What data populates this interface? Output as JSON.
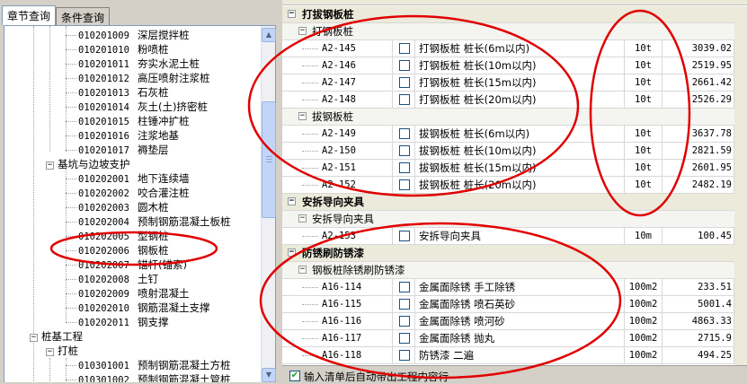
{
  "tabs": [
    {
      "label": "章节查询",
      "active": true
    },
    {
      "label": "条件查询",
      "active": false
    }
  ],
  "tree": {
    "items_a": [
      {
        "code": "010201009",
        "name": "深层搅拌桩"
      },
      {
        "code": "010201010",
        "name": "粉喷桩"
      },
      {
        "code": "010201011",
        "name": "夯实水泥土桩"
      },
      {
        "code": "010201012",
        "name": "高压喷射注浆桩"
      },
      {
        "code": "010201013",
        "name": "石灰桩"
      },
      {
        "code": "010201014",
        "name": "灰土(土)挤密桩"
      },
      {
        "code": "010201015",
        "name": "柱锤冲扩桩"
      },
      {
        "code": "010201016",
        "name": "注浆地基"
      },
      {
        "code": "010201017",
        "name": "褥垫层"
      }
    ],
    "group_pit": "基坑与边坡支护",
    "items_b": [
      {
        "code": "010202001",
        "name": "地下连续墙"
      },
      {
        "code": "010202002",
        "name": "咬合灌注桩"
      },
      {
        "code": "010202003",
        "name": "圆木桩"
      },
      {
        "code": "010202004",
        "name": "预制钢筋混凝土板桩"
      },
      {
        "code": "010202005",
        "name": "型钢桩"
      },
      {
        "code": "010202006",
        "name": "钢板桩"
      },
      {
        "code": "010202007",
        "name": "锚杆(锚索)"
      },
      {
        "code": "010202008",
        "name": "土钉"
      },
      {
        "code": "010202009",
        "name": "喷射混凝土"
      },
      {
        "code": "010202010",
        "name": "钢筋混凝土支撑"
      },
      {
        "code": "010202011",
        "name": "钢支撑"
      }
    ],
    "group_pile": "桩基工程",
    "group_driven": "打桩",
    "items_c": [
      {
        "code": "010301001",
        "name": "预制钢筋混凝土方桩"
      },
      {
        "code": "010301002",
        "name": "预制钢筋混凝土管桩"
      }
    ]
  },
  "table": {
    "sections": [
      {
        "title": "打拔钢板桩",
        "subs": [
          {
            "title": "打钢板桩",
            "rows": [
              {
                "code": "A2-145",
                "name": "打钢板桩 桩长(6m以内)",
                "unit": "10t",
                "price": "3039.02"
              },
              {
                "code": "A2-146",
                "name": "打钢板桩 桩长(10m以内)",
                "unit": "10t",
                "price": "2519.95"
              },
              {
                "code": "A2-147",
                "name": "打钢板桩 桩长(15m以内)",
                "unit": "10t",
                "price": "2661.42"
              },
              {
                "code": "A2-148",
                "name": "打钢板桩 桩长(20m以内)",
                "unit": "10t",
                "price": "2526.29"
              }
            ]
          },
          {
            "title": "拔钢板桩",
            "rows": [
              {
                "code": "A2-149",
                "name": "拔钢板桩 桩长(6m以内)",
                "unit": "10t",
                "price": "3637.78"
              },
              {
                "code": "A2-150",
                "name": "拔钢板桩 桩长(10m以内)",
                "unit": "10t",
                "price": "2821.59"
              },
              {
                "code": "A2-151",
                "name": "拔钢板桩 桩长(15m以内)",
                "unit": "10t",
                "price": "2601.95"
              },
              {
                "code": "A2-152",
                "name": "拔钢板桩 桩长(20m以内)",
                "unit": "10t",
                "price": "2482.19"
              }
            ]
          }
        ]
      },
      {
        "title": "安拆导向夹具",
        "subs": [
          {
            "title": "安拆导向夹具",
            "rows": [
              {
                "code": "A2-153",
                "name": "安拆导向夹具",
                "unit": "10m",
                "price": "100.45"
              }
            ]
          }
        ]
      },
      {
        "title": "防锈刷防锈漆",
        "subs": [
          {
            "title": "钢板桩除锈刷防锈漆",
            "rows": [
              {
                "code": "A16-114",
                "name": "金属面除锈 手工除锈",
                "unit": "100m2",
                "price": "233.51"
              },
              {
                "code": "A16-115",
                "name": "金属面除锈 喷石英砂",
                "unit": "100m2",
                "price": "5001.4"
              },
              {
                "code": "A16-116",
                "name": "金属面除锈 喷河砂",
                "unit": "100m2",
                "price": "4863.33"
              },
              {
                "code": "A16-117",
                "name": "金属面除锈 抛丸",
                "unit": "100m2",
                "price": "2715.9"
              },
              {
                "code": "A16-118",
                "name": "防锈漆 二遍",
                "unit": "100m2",
                "price": "494.25"
              }
            ]
          }
        ]
      }
    ]
  },
  "bottom": {
    "checkbox_checked": true,
    "label": "输入清单后自动带出工程内容行"
  },
  "colors": {
    "annotation": "#e00000",
    "group_bg": "#ebeadb",
    "tree_border": "#7f9db9"
  }
}
